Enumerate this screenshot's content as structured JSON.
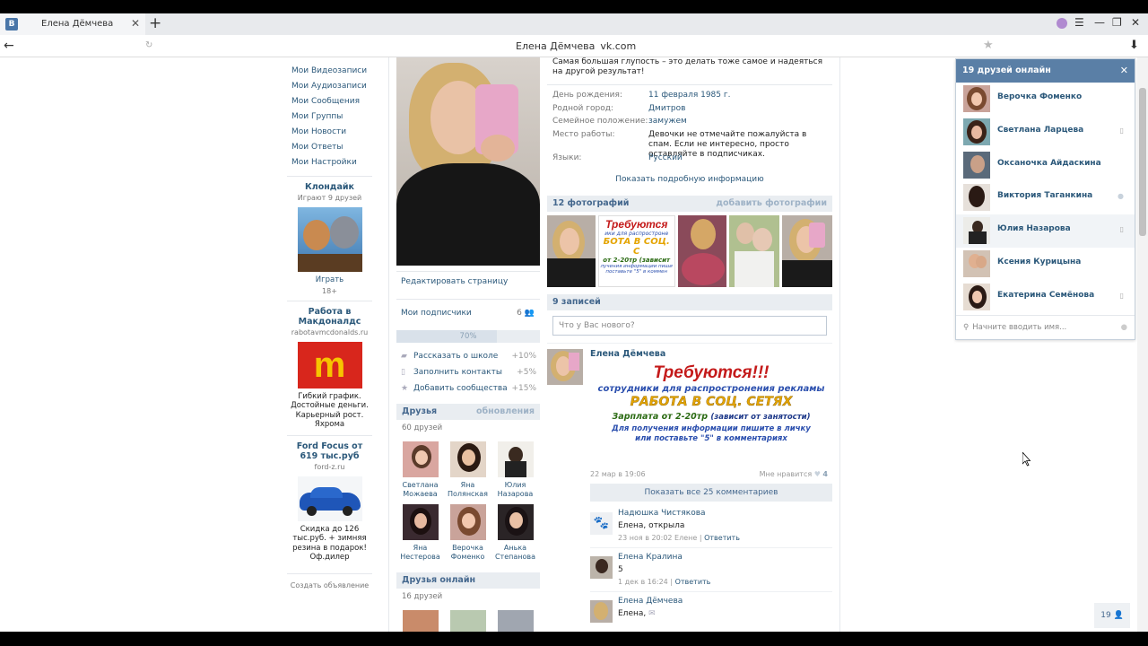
{
  "browser": {
    "tab_title": "Елена Дёмчева",
    "tab_icon": "В",
    "page_title": "Елена Дёмчева",
    "domain": "vk.com"
  },
  "left_menu": [
    "Мои Видеозаписи",
    "Мои Аудиозаписи",
    "Мои Сообщения",
    "Мои Группы",
    "Мои Новости",
    "Мои Ответы",
    "Мои Настройки"
  ],
  "ads": [
    {
      "title": "Клондайк",
      "sub": "Играют 9 друзей",
      "text1": "Играть",
      "text2": "18+"
    },
    {
      "title": "Работа в Макдоналдс",
      "sub": "rabotavmcdonalds.ru",
      "text": "Гибкий график. Достойные деньги. Карьерный рост. Яхрома"
    },
    {
      "title": "Ford Focus от 619 тыс.руб",
      "sub": "ford-z.ru",
      "text": "Скидка до 126 тыс.руб. + зимняя резина в подарок! Оф.дилер"
    }
  ],
  "ad_create": "Создать объявление",
  "profile": {
    "edit_page": "Редактировать страницу",
    "subscribers_label": "Мои подписчики",
    "subscribers_count": "6",
    "progress_text": "70%",
    "progress_value": 0.7,
    "bonuses": [
      {
        "label": "Рассказать о школе",
        "value": "+10%"
      },
      {
        "label": "Заполнить контакты",
        "value": "+5%"
      },
      {
        "label": "Добавить сообщества",
        "value": "+15%"
      }
    ],
    "friends_title": "Друзья",
    "friends_updates": "обновления",
    "friends_count": "60 друзей",
    "friends": [
      {
        "first": "Светлана",
        "last": "Можаева"
      },
      {
        "first": "Яна",
        "last": "Полянская"
      },
      {
        "first": "Юлия",
        "last": "Назарова"
      },
      {
        "first": "Яна",
        "last": "Нестерова"
      },
      {
        "first": "Верочка",
        "last": "Фоменко"
      },
      {
        "first": "Анька",
        "last": "Степанова"
      }
    ],
    "online_title": "Друзья онлайн",
    "online_count": "16 друзей"
  },
  "info": {
    "status": "Самая большая глупость – это делать тоже самое и надеяться на другой результат!",
    "rows": [
      {
        "key": "День рождения:",
        "value": "11 февраля 1985 г."
      },
      {
        "key": "Родной город:",
        "value": "Дмитров"
      },
      {
        "key": "Семейное положение:",
        "value": "замужем"
      },
      {
        "key": "Место работы:",
        "value": "Девочки не отмечайте пожалуйста в спам. Если не интересно, просто оставляйте в подписчиках."
      },
      {
        "key": "Языки:",
        "value": "Русский"
      }
    ],
    "more": "Показать подробную информацию"
  },
  "photos": {
    "title": "12 фотографий",
    "add": "добавить фотографии"
  },
  "wall": {
    "title": "9 записей",
    "placeholder": "Что у Вас нового?",
    "post_author": "Елена Дёмчева",
    "post_lines": [
      "Требуются!!!",
      "сотрудники для распростронения рекламы",
      "РАБОТА В СОЦ. СЕТЯХ",
      "Зарплата от 2-20тр",
      "(зависит от занятости)",
      "Для получения информации пишите в личку",
      "или поставьте \"5\" в комментариях"
    ],
    "post_date": "22 мар в 19:06",
    "post_like": "Мне нравится",
    "post_like_count": "4",
    "show_comments": "Показать все 25 комментариев",
    "comments": [
      {
        "author": "Надюшка Чистякова",
        "text": "Елена, открыла",
        "date": "23 ноя в 20:02 Елене",
        "reply": "Ответить"
      },
      {
        "author": "Елена Кралина",
        "text": "5",
        "date": "1 дек в 16:24",
        "reply": "Ответить"
      },
      {
        "author": "Елена Дёмчева",
        "text": "Елена,",
        "date": "",
        "reply": ""
      }
    ]
  },
  "online_panel": {
    "title": "19 друзей онлайн",
    "friends": [
      "Верочка Фоменко",
      "Светлана Ларцева",
      "Оксаночка Айдаскина",
      "Виктория Таганкина",
      "Юлия Назарова",
      "Ксения Курицына",
      "Екатерина Семёнова"
    ],
    "search_placeholder": "Начните вводить имя..."
  },
  "friends_counter": "19",
  "colors": {
    "vk_blue": "#4a76a8",
    "link": "#2b587a",
    "header": "#5a7fa6"
  }
}
